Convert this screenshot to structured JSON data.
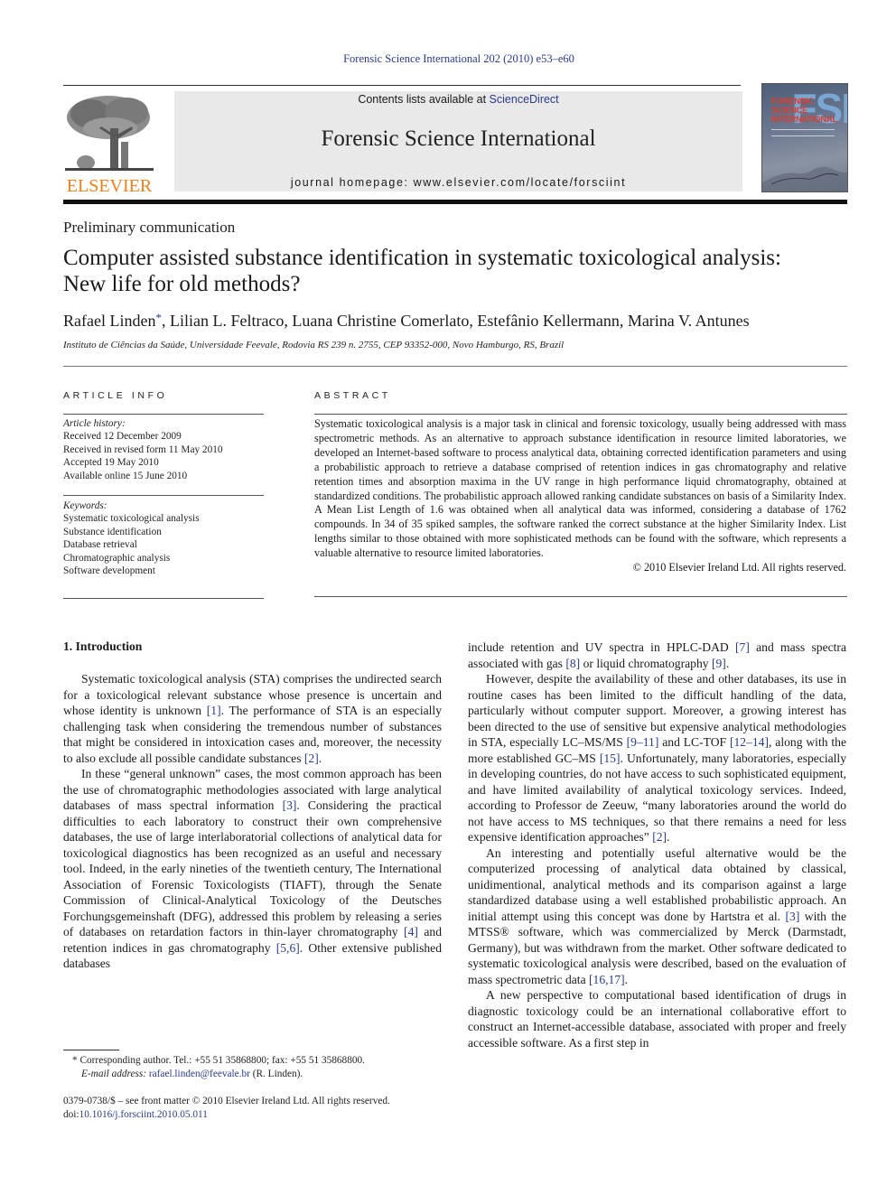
{
  "journal_ref": "Forensic Science International 202 (2010) e53–e60",
  "header": {
    "contents_prefix": "Contents lists available at ",
    "contents_link": "ScienceDirect",
    "journal_title": "Forensic Science International",
    "homepage": "journal homepage: www.elsevier.com/locate/forsciint",
    "publisher_logo": "ELSEVIER",
    "cover": {
      "big_letters": "FSI",
      "title_lines": [
        "FORENSIC",
        "SCIENCE",
        "INTERNATIONAL"
      ]
    }
  },
  "article": {
    "type": "Preliminary communication",
    "title_line1": "Computer assisted substance identification in systematic toxicological analysis:",
    "title_line2": "New life for old methods?",
    "authors": {
      "first": "Rafael Linden",
      "mark": "*",
      "rest": ", Lilian L. Feltraco, Luana Christine Comerlato, Estefânio Kellermann, Marina V. Antunes"
    },
    "affiliation": "Instituto de Ciências da Saúde, Universidade Feevale, Rodovia RS 239 n. 2755, CEP 93352-000, Novo Hamburgo, RS, Brazil"
  },
  "article_info": {
    "heading": "ARTICLE INFO",
    "history_label": "Article history:",
    "history": [
      "Received 12 December 2009",
      "Received in revised form 11 May 2010",
      "Accepted 19 May 2010",
      "Available online 15 June 2010"
    ],
    "keywords_label": "Keywords:",
    "keywords": [
      "Systematic toxicological analysis",
      "Substance identification",
      "Database retrieval",
      "Chromatographic analysis",
      "Software development"
    ]
  },
  "abstract": {
    "heading": "ABSTRACT",
    "text": "Systematic toxicological analysis is a major task in clinical and forensic toxicology, usually being addressed with mass spectrometric methods. As an alternative to approach substance identification in resource limited laboratories, we developed an Internet-based software to process analytical data, obtaining corrected identification parameters and using a probabilistic approach to retrieve a database comprised of retention indices in gas chromatography and relative retention times and absorption maxima in the UV range in high performance liquid chromatography, obtained at standardized conditions. The probabilistic approach allowed ranking candidate substances on basis of a Similarity Index. A Mean List Length of 1.6 was obtained when all analytical data was informed, considering a database of 1762 compounds. In 34 of 35 spiked samples, the software ranked the correct substance at the higher Similarity Index. List lengths similar to those obtained with more sophisticated methods can be found with the software, which represents a valuable alternative to resource limited laboratories.",
    "copyright": "© 2010 Elsevier Ireland Ltd. All rights reserved."
  },
  "body": {
    "section_heading": "1. Introduction",
    "left": {
      "p1": [
        {
          "t": "Systematic toxicological analysis (STA) comprises the undi­rected search for a toxicological relevant substance whose presence is uncertain and whose identity is unknown "
        },
        {
          "r": "[1]"
        },
        {
          "t": ". The performance of STA is an especially challenging task when considering the tremendous number of substances that might be considered in intoxication cases and, moreover, the necessity to also exclude all possible candidate substances "
        },
        {
          "r": "[2]"
        },
        {
          "t": "."
        }
      ],
      "p2": [
        {
          "t": "In these “general unknown” cases, the most common approach has been the use of chromatographic methodologies associated with large analytical databases of mass spectral information "
        },
        {
          "r": "[3]"
        },
        {
          "t": ". Considering the practical difficulties to each laboratory to construct their own comprehensive databases, the use of large interlaboratorial collections of analytical data for toxicological diagnostics has been recognized as an useful and necessary tool. Indeed, in the early nineties of the twentieth century, The International Association of Forensic Toxicologists (TIAFT), through the Senate Commission of Clinical-Analytical Toxicology of the Deutsches Forchungsgemeinshaft (DFG), addressed this problem by releasing a series of databases on retardation factors in thin-layer chromatography "
        },
        {
          "r": "[4]"
        },
        {
          "t": " and retention indices in gas chromatography "
        },
        {
          "r": "[5,6]"
        },
        {
          "t": ". Other extensive published databases"
        }
      ]
    },
    "right": {
      "p0": [
        {
          "t": "include retention and UV spectra in HPLC-DAD "
        },
        {
          "r": "[7]"
        },
        {
          "t": " and mass spectra associated with gas "
        },
        {
          "r": "[8]"
        },
        {
          "t": " or liquid chromatography "
        },
        {
          "r": "[9]"
        },
        {
          "t": "."
        }
      ],
      "p1": [
        {
          "t": "However, despite the availability of these and other databases, its use in routine cases has been limited to the difficult handling of the data, particularly without computer support. Moreover, a growing interest has been directed to the use of sensitive but expensive analytical methodologies in STA, especially LC–MS/MS "
        },
        {
          "r": "[9–11]"
        },
        {
          "t": " and LC-TOF "
        },
        {
          "r": "[12–14]"
        },
        {
          "t": ", along with the more established GC–MS "
        },
        {
          "r": "[15]"
        },
        {
          "t": ". Unfortunately, many laboratories, especially in developing coun­tries, do not have access to such sophisticated equipment, and have limited availability of analytical toxicology services. Indeed, according to Professor de Zeeuw, “many laboratories around the world do not have access to MS techniques, so that there remains a need for less expensive identification approaches” "
        },
        {
          "r": "[2]"
        },
        {
          "t": "."
        }
      ],
      "p2": [
        {
          "t": "An interesting and potentially useful alternative would be the computerized processing of analytical data obtained by classical, unidimentional, analytical methods and its comparison against a large standardized database using a well established probabilistic approach. An initial attempt using this concept was done by Hartstra et al. "
        },
        {
          "r": "[3]"
        },
        {
          "t": " with the MTSS® software, which was commercialized by Merck (Darmstadt, Germany), but was withdrawn from the market. Other software dedicated to systematic toxicological analysis were described, based on the evaluation of mass spectrometric data "
        },
        {
          "r": "[16,17]"
        },
        {
          "t": "."
        }
      ],
      "p3": [
        {
          "t": "A new perspective to computational based identification of drugs in diagnostic toxicology could be an international collabo­rative effort to construct an Internet-accessible database, associ­ated with proper and freely accessible software. As a first step in"
        }
      ]
    }
  },
  "footnote": {
    "mark": "*",
    "corresponding": "Corresponding author. Tel.: +55 51 35868800; fax: +55 51 35868800.",
    "email_label": "E-mail address:",
    "email": "rafael.linden@feevale.br",
    "email_suffix": " (R. Linden)."
  },
  "frontmatter": {
    "issn_line": "0379-0738/$ – see front matter © 2010 Elsevier Ireland Ltd. All rights reserved.",
    "doi_prefix": "doi:",
    "doi": "10.1016/j.forsciint.2010.05.011"
  },
  "colors": {
    "link": "#2a3a8c",
    "elsevier_orange": "#f07f1a",
    "header_box": "#e9e9e9"
  }
}
